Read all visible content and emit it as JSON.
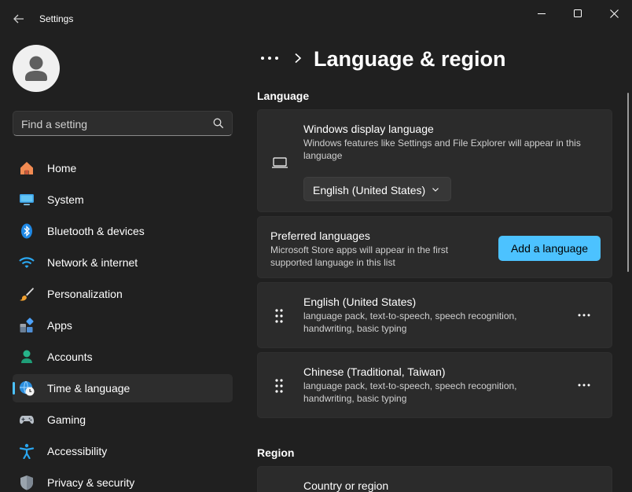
{
  "window": {
    "title": "Settings",
    "controls": [
      "minimize",
      "maximize",
      "close"
    ]
  },
  "sidebar": {
    "search": {
      "placeholder": "Find a setting"
    },
    "items": [
      {
        "label": "Home",
        "icon": "home-icon"
      },
      {
        "label": "System",
        "icon": "system-icon"
      },
      {
        "label": "Bluetooth & devices",
        "icon": "bluetooth-icon"
      },
      {
        "label": "Network & internet",
        "icon": "wifi-icon"
      },
      {
        "label": "Personalization",
        "icon": "brush-icon"
      },
      {
        "label": "Apps",
        "icon": "apps-icon"
      },
      {
        "label": "Accounts",
        "icon": "accounts-icon"
      },
      {
        "label": "Time & language",
        "icon": "globe-clock-icon",
        "selected": true
      },
      {
        "label": "Gaming",
        "icon": "gamepad-icon"
      },
      {
        "label": "Accessibility",
        "icon": "accessibility-icon"
      },
      {
        "label": "Privacy & security",
        "icon": "shield-icon"
      }
    ]
  },
  "header": {
    "more": "•••",
    "title": "Language & region"
  },
  "language": {
    "section_title": "Language",
    "display_language": {
      "title": "Windows display language",
      "description": "Windows features like Settings and File Explorer will appear in this language",
      "selected": "English (United States)"
    },
    "preferred": {
      "title": "Preferred languages",
      "description": "Microsoft Store apps will appear in the first supported language in this list",
      "button": "Add a language"
    },
    "languages": [
      {
        "name": "English (United States)",
        "details": "language pack, text-to-speech, speech recognition, handwriting, basic typing"
      },
      {
        "name": "Chinese (Traditional, Taiwan)",
        "details": "language pack, text-to-speech, speech recognition, handwriting, basic typing"
      }
    ]
  },
  "region": {
    "section_title": "Region",
    "country": {
      "title": "Country or region"
    }
  },
  "colors": {
    "background": "#202020",
    "card": "#2b2b2b",
    "accent": "#4cc2ff",
    "selected_nav": "#2d2d2d"
  }
}
